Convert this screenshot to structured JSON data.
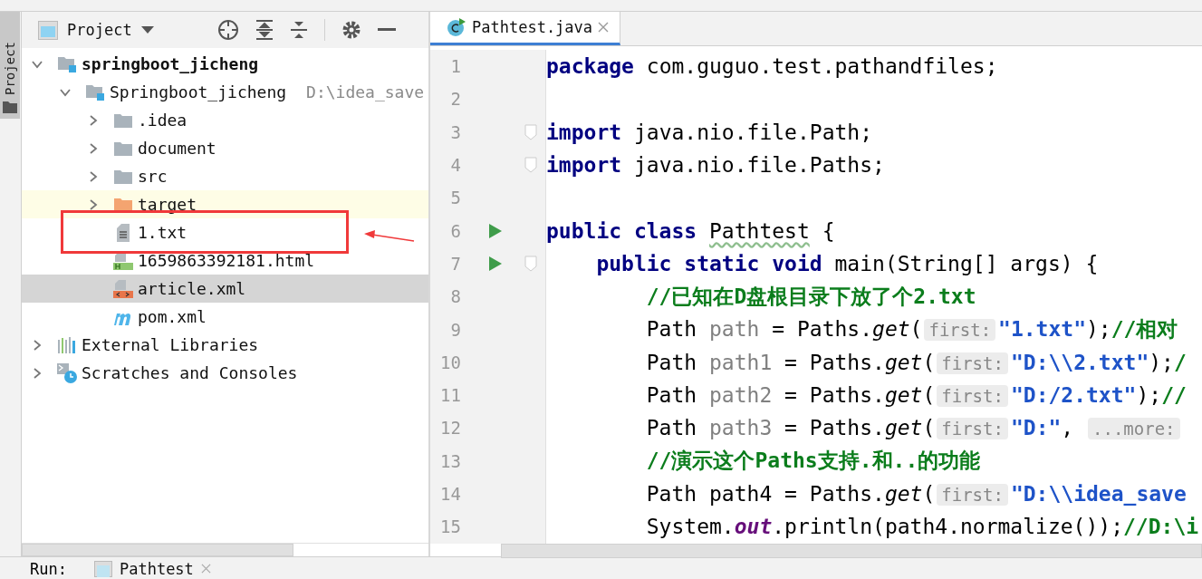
{
  "left_stripe": {
    "tabs": [
      {
        "label": "Project",
        "selected": true
      }
    ]
  },
  "project_panel": {
    "title": "Project",
    "tree": [
      {
        "label": "springboot_jicheng",
        "kind": "module",
        "bold": true,
        "expanded": true,
        "selected": false,
        "highlighted": false,
        "children": [
          {
            "label": "Springboot_jicheng",
            "path": "D:\\idea_save",
            "kind": "module",
            "expanded": true,
            "selected": false,
            "highlighted": false,
            "children": [
              {
                "label": ".idea",
                "kind": "folder",
                "expanded": false,
                "selected": false,
                "highlighted": false
              },
              {
                "label": "document",
                "kind": "folder",
                "expanded": false,
                "selected": false,
                "highlighted": false
              },
              {
                "label": "src",
                "kind": "folder",
                "expanded": false,
                "selected": false,
                "highlighted": false
              },
              {
                "label": "target",
                "kind": "excluded",
                "expanded": false,
                "selected": false,
                "highlighted": true
              },
              {
                "label": "1.txt",
                "kind": "text",
                "selected": false,
                "highlighted": false
              },
              {
                "label": "1659863392181.html",
                "kind": "html",
                "selected": false,
                "highlighted": false
              },
              {
                "label": "article.xml",
                "kind": "xml",
                "selected": true,
                "highlighted": false
              },
              {
                "label": "pom.xml",
                "kind": "maven",
                "selected": false,
                "highlighted": false
              }
            ]
          }
        ]
      },
      {
        "label": "External Libraries",
        "kind": "libraries",
        "expanded": false,
        "selected": false,
        "highlighted": false
      },
      {
        "label": "Scratches and Consoles",
        "kind": "scratches",
        "expanded": false,
        "selected": false,
        "highlighted": false
      }
    ]
  },
  "editor": {
    "tabs": [
      {
        "label": "Pathtest.java",
        "selected": true
      }
    ],
    "lines": [
      {
        "number": "1",
        "tokens": [
          {
            "kind": "kw",
            "text": "package"
          },
          {
            "kind": "plain",
            "text": " com.guguo.test.pathandfiles;"
          }
        ]
      },
      {
        "number": "2"
      },
      {
        "number": "3",
        "fold": true,
        "tokens": [
          {
            "kind": "kw",
            "text": "import"
          },
          {
            "kind": "plain",
            "text": " java.nio.file.Path;"
          }
        ]
      },
      {
        "number": "4",
        "fold": true,
        "tokens": [
          {
            "kind": "kw",
            "text": "import"
          },
          {
            "kind": "plain",
            "text": " java.nio.file.Paths;"
          }
        ]
      },
      {
        "number": "5"
      },
      {
        "number": "6",
        "run": true,
        "tokens": [
          {
            "kind": "kw",
            "text": "public class "
          },
          {
            "kind": "warn",
            "text": "Pathtest"
          },
          {
            "kind": "plain",
            "text": " {"
          }
        ]
      },
      {
        "number": "7",
        "run": true,
        "fold": true,
        "tokens": [
          {
            "kind": "kw",
            "text": "    public static void "
          },
          {
            "kind": "plain",
            "text": "main(String[] args) {"
          }
        ]
      },
      {
        "number": "8",
        "tokens": [
          {
            "kind": "comment",
            "text": "        //已知在D盘根目录下放了个2.txt"
          }
        ]
      },
      {
        "number": "9",
        "tokens": [
          {
            "kind": "plain",
            "text": "        Path "
          },
          {
            "kind": "local",
            "text": "path"
          },
          {
            "kind": "plain",
            "text": " = Paths."
          },
          {
            "kind": "call",
            "text": "get"
          },
          {
            "kind": "plain",
            "text": "("
          },
          {
            "kind": "hint",
            "text": "first:"
          },
          {
            "kind": "str",
            "text": "\"1.txt\""
          },
          {
            "kind": "plain",
            "text": ");"
          },
          {
            "kind": "comment",
            "text": "//相对"
          }
        ]
      },
      {
        "number": "10",
        "tokens": [
          {
            "kind": "plain",
            "text": "        Path "
          },
          {
            "kind": "local",
            "text": "path1"
          },
          {
            "kind": "plain",
            "text": " = Paths."
          },
          {
            "kind": "call",
            "text": "get"
          },
          {
            "kind": "plain",
            "text": "("
          },
          {
            "kind": "hint",
            "text": "first:"
          },
          {
            "kind": "str",
            "text": "\"D:\\\\2.txt\""
          },
          {
            "kind": "plain",
            "text": ");"
          },
          {
            "kind": "comment",
            "text": "/"
          }
        ]
      },
      {
        "number": "11",
        "tokens": [
          {
            "kind": "plain",
            "text": "        Path "
          },
          {
            "kind": "local",
            "text": "path2"
          },
          {
            "kind": "plain",
            "text": " = Paths."
          },
          {
            "kind": "call",
            "text": "get"
          },
          {
            "kind": "plain",
            "text": "("
          },
          {
            "kind": "hint",
            "text": "first:"
          },
          {
            "kind": "str",
            "text": "\"D:/2.txt\""
          },
          {
            "kind": "plain",
            "text": ");"
          },
          {
            "kind": "comment",
            "text": "//"
          }
        ]
      },
      {
        "number": "12",
        "tokens": [
          {
            "kind": "plain",
            "text": "        Path "
          },
          {
            "kind": "local",
            "text": "path3"
          },
          {
            "kind": "plain",
            "text": " = Paths."
          },
          {
            "kind": "call",
            "text": "get"
          },
          {
            "kind": "plain",
            "text": "("
          },
          {
            "kind": "hint",
            "text": "first:"
          },
          {
            "kind": "str",
            "text": "\"D:\""
          },
          {
            "kind": "plain",
            "text": ", "
          },
          {
            "kind": "hint",
            "text": "...more:"
          }
        ]
      },
      {
        "number": "13",
        "tokens": [
          {
            "kind": "comment",
            "text": "        //演示这个Paths支持.和..的功能"
          }
        ]
      },
      {
        "number": "14",
        "tokens": [
          {
            "kind": "plain",
            "text": "        Path path4 = Paths."
          },
          {
            "kind": "call",
            "text": "get"
          },
          {
            "kind": "plain",
            "text": "("
          },
          {
            "kind": "hint",
            "text": "first:"
          },
          {
            "kind": "str",
            "text": "\"D:\\\\idea_save"
          }
        ]
      },
      {
        "number": "15",
        "tokens": [
          {
            "kind": "plain",
            "text": "        System."
          },
          {
            "kind": "field",
            "text": "out"
          },
          {
            "kind": "plain",
            "text": ".println(path4.normalize());"
          },
          {
            "kind": "comment",
            "text": "//D:\\i"
          }
        ]
      }
    ]
  },
  "bottom_bar": {
    "label": "Run:",
    "tabs": [
      {
        "label": "Pathtest",
        "selected": true
      }
    ]
  }
}
